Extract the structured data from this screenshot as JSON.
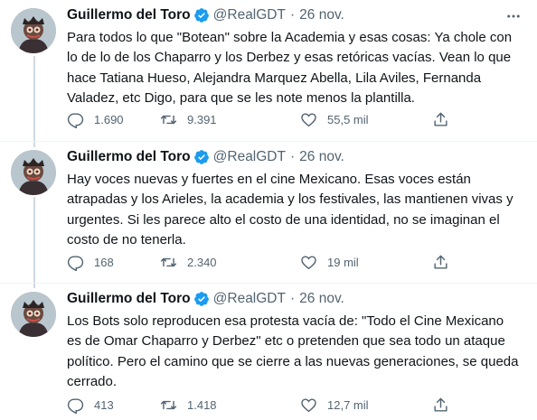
{
  "colors": {
    "verified": "#1d9bf0",
    "secondary_text": "#536471",
    "thread_line": "#cfd9de"
  },
  "tweets": [
    {
      "author_name": "Guillermo del Toro",
      "handle": "@RealGDT",
      "separator": "·",
      "timestamp": "26 nov.",
      "text_lines": [
        "Para todos lo que \"Botean\" sobre la Academia y esas cosas: Ya chole con",
        "lo de lo de los Chaparro y los Derbez y esas retóricas vacías. Vean lo que",
        "hace Tatiana Hueso, Alejandra Marquez Abella, Lila Aviles, Fernanda",
        "Valadez, etc  Digo, para que se les note menos la plantilla."
      ],
      "replies": "1.690",
      "retweets": "9.391",
      "likes": "55,5 mil"
    },
    {
      "author_name": "Guillermo del Toro",
      "handle": "@RealGDT",
      "separator": "·",
      "timestamp": "26 nov.",
      "text_lines": [
        "Hay voces nuevas y fuertes en el cine Mexicano.  Esas voces están",
        "atrapadas y los Arieles, la academia y los festivales, las mantienen vivas y",
        "urgentes.  Si les parece alto el costo de una identidad, no se imaginan el",
        "costo de no tenerla."
      ],
      "replies": "168",
      "retweets": "2.340",
      "likes": "19 mil"
    },
    {
      "author_name": "Guillermo del Toro",
      "handle": "@RealGDT",
      "separator": "·",
      "timestamp": "26 nov.",
      "text_lines": [
        "Los Bots solo reproducen esa protesta vacía de:  \"Todo el Cine Mexicano",
        "es de Omar Chaparro y Derbez\" etc o pretenden que sea todo un ataque",
        "político.  Pero el camino que se cierre a las nuevas generaciones, se queda",
        "cerrado."
      ],
      "replies": "413",
      "retweets": "1.418",
      "likes": "12,7 mil"
    }
  ]
}
